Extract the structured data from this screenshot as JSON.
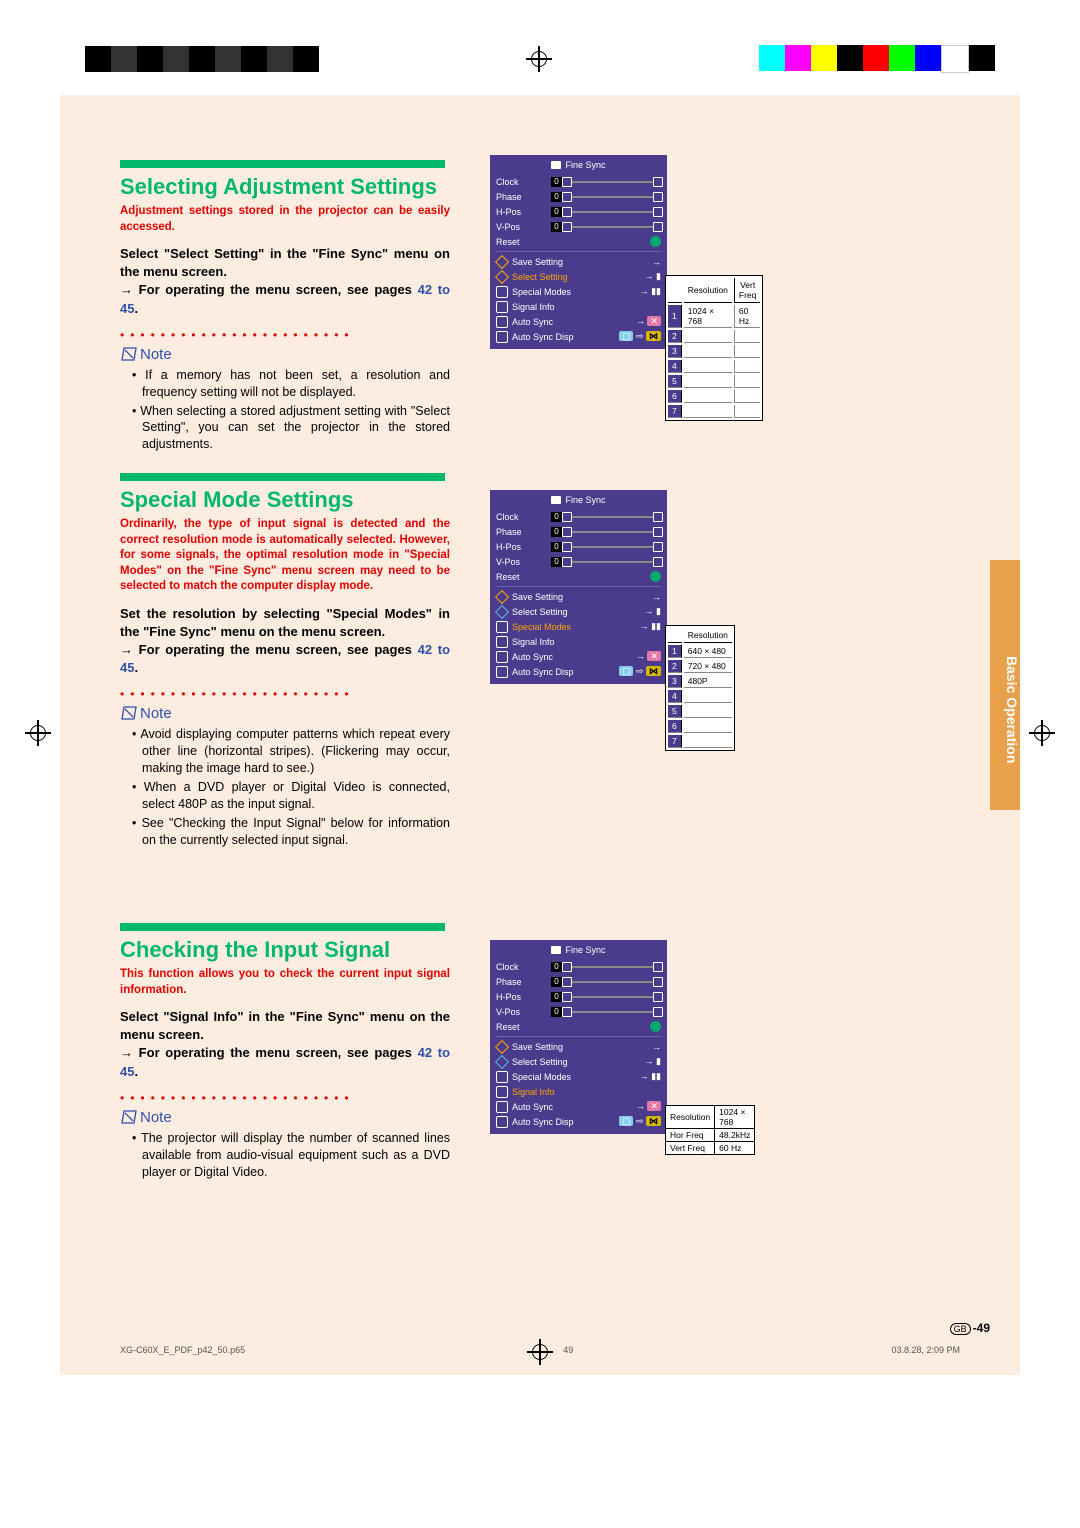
{
  "registration_colors_left": [
    "#000",
    "#333",
    "#000",
    "#333",
    "#000",
    "#333",
    "#000",
    "#333",
    "#000"
  ],
  "registration_colors_right": [
    "#0FF",
    "#F0F",
    "#FF0",
    "#000",
    "#F00",
    "#0F0",
    "#00F",
    "#FFF",
    "#000"
  ],
  "section_tab": "Basic Operation",
  "page_num_prefix": "GB",
  "page_num": "-49",
  "footer": {
    "file": "XG-C60X_E_PDF_p42_50.p65",
    "page": "49",
    "datetime": "03.8.28, 2:09 PM"
  },
  "note_label": "Note",
  "sections": {
    "s1": {
      "heading": "Selecting Adjustment Settings",
      "intro": "Adjustment settings stored in the projector can be easily accessed.",
      "body_a": "Select \"Select Setting\" in the \"Fine Sync\" menu on the menu screen.",
      "body_b_pre": "→ For operating the menu screen, see pages ",
      "body_b_link": "42 to 45",
      "body_b_post": ".",
      "notes": [
        "If a memory has not been set, a resolution and frequency setting will not be displayed.",
        "When selecting a stored adjustment setting with \"Select Setting\", you can set the projector in the stored adjustments."
      ],
      "table": {
        "h1": "Resolution",
        "h2": "Vert Freq",
        "row1_res": "1024 × 768",
        "row1_freq": "60 Hz"
      }
    },
    "s2": {
      "heading": "Special Mode Settings",
      "intro": "Ordinarily, the type of input signal is detected and the correct resolution mode is automatically selected. However, for some signals, the optimal resolution mode in \"Special Modes\" on the \"Fine Sync\" menu screen may need to be selected to match the computer display mode.",
      "body_a": "Set the resolution by selecting \"Special Modes\" in the \"Fine Sync\" menu on the menu screen.",
      "body_b_pre": "→ For operating the menu screen, see pages ",
      "body_b_link": "42 to 45",
      "body_b_post": ".",
      "notes": [
        "Avoid displaying computer patterns which repeat every other line (horizontal stripes). (Flickering may occur, making the image hard to see.)",
        "When a DVD player or Digital Video is connected, select 480P as the input signal.",
        "See \"Checking the Input Signal\" below for information on the currently selected input signal."
      ],
      "table": {
        "h1": "Resolution",
        "rows": [
          "640 × 480",
          "720 × 480",
          "480P"
        ]
      }
    },
    "s3": {
      "heading": "Checking the Input Signal",
      "intro": "This function allows you to check the current input signal information.",
      "body_a": "Select \"Signal Info\" in the \"Fine Sync\" menu on the menu screen.",
      "body_b_pre": "→ For operating the menu screen, see pages ",
      "body_b_link": "42 to 45",
      "body_b_post": ".",
      "notes": [
        "The projector will display the number of scanned lines available from audio-visual equipment such as a DVD player or Digital Video."
      ],
      "table": {
        "rows": [
          [
            "Resolution",
            "1024 × 768"
          ],
          [
            "Hor Freq",
            "48.2kHz"
          ],
          [
            "Vert Freq",
            "60 Hz"
          ]
        ]
      }
    }
  },
  "fine_sync": {
    "title": "Fine Sync",
    "items": [
      "Clock",
      "Phase",
      "H-Pos",
      "V-Pos"
    ],
    "reset": "Reset",
    "save": "Save Setting",
    "select": "Select Setting",
    "special": "Special Modes",
    "signal": "Signal Info",
    "autosync": "Auto Sync",
    "autosyncdisp": "Auto Sync Disp"
  }
}
